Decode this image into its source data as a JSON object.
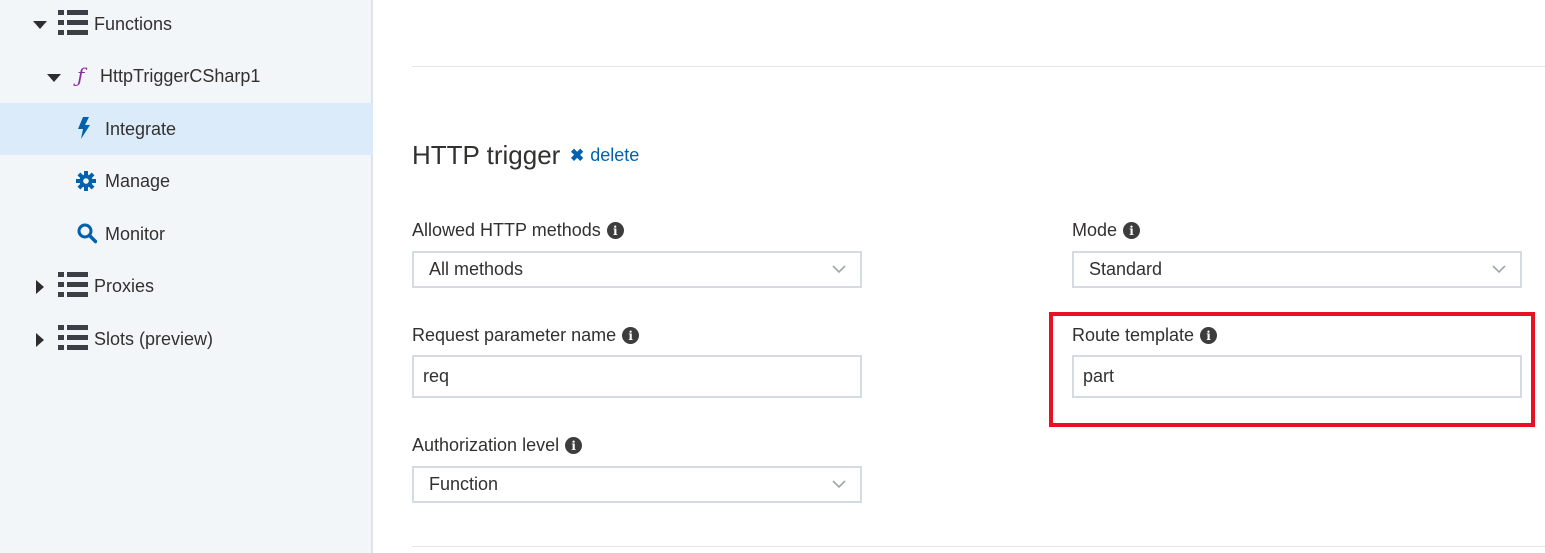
{
  "sidebar": {
    "items": [
      {
        "label": "Functions",
        "icon": "list-icon",
        "expanded": true
      },
      {
        "label": "HttpTriggerCSharp1",
        "icon": "function-icon",
        "expanded": true
      },
      {
        "label": "Integrate",
        "icon": "lightning-icon",
        "selected": true
      },
      {
        "label": "Manage",
        "icon": "gear-icon"
      },
      {
        "label": "Monitor",
        "icon": "search-icon"
      },
      {
        "label": "Proxies",
        "icon": "list-icon",
        "expanded": false
      },
      {
        "label": "Slots (preview)",
        "icon": "list-icon",
        "expanded": false
      }
    ],
    "function_glyph": "ƒ"
  },
  "trigger": {
    "title": "HTTP trigger",
    "delete_label": "delete"
  },
  "form": {
    "allowed_methods": {
      "label": "Allowed HTTP methods",
      "value": "All methods"
    },
    "mode": {
      "label": "Mode",
      "value": "Standard"
    },
    "request_param": {
      "label": "Request parameter name",
      "value": "req"
    },
    "route_template": {
      "label": "Route template",
      "value": "part"
    },
    "auth_level": {
      "label": "Authorization level",
      "value": "Function"
    },
    "info_glyph": "i"
  },
  "colors": {
    "accent": "#0062ad",
    "selected_bg": "#dcebf9",
    "highlight": "#e81123",
    "function_icon": "#8a2f9e"
  }
}
